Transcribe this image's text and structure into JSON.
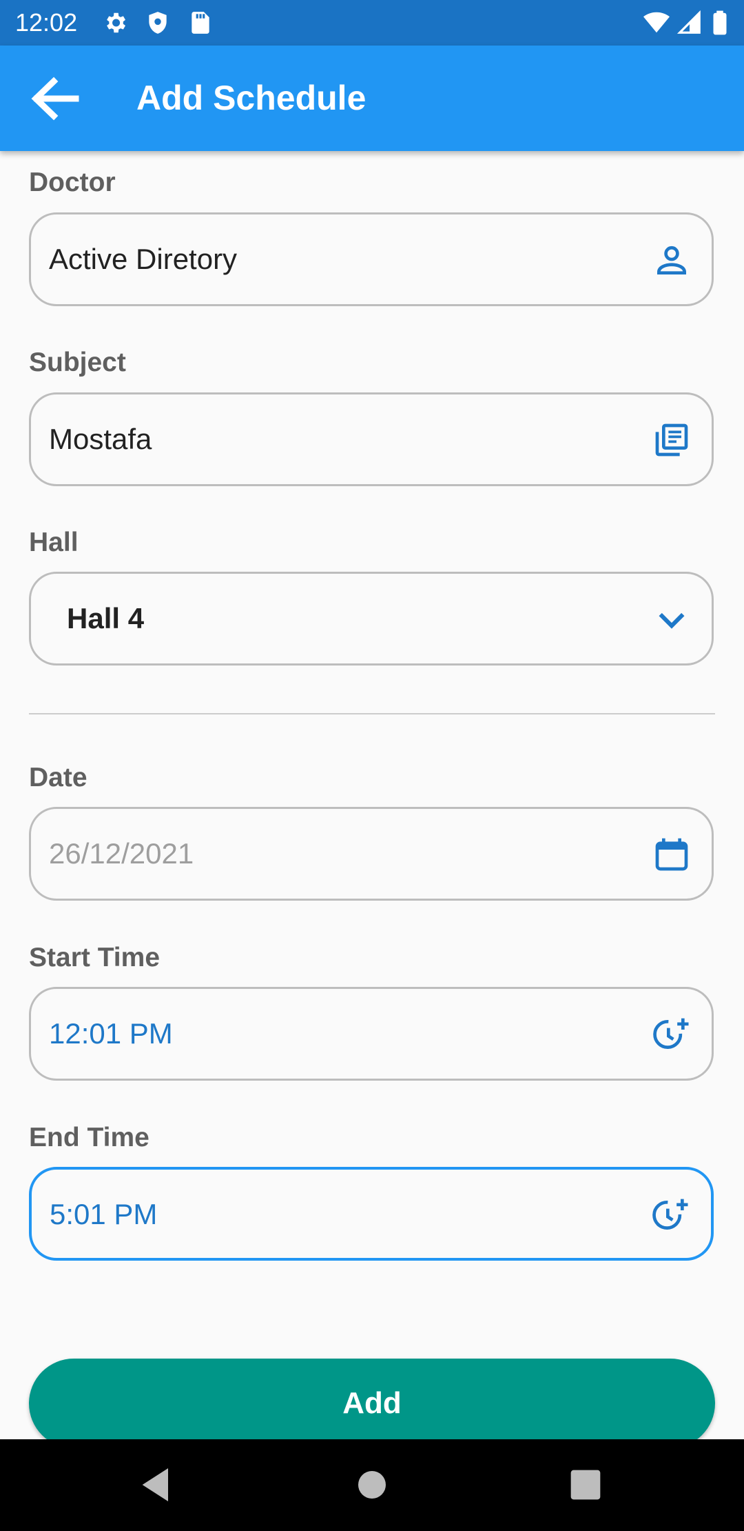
{
  "status_bar": {
    "time": "12:02",
    "icons": [
      "gear-icon",
      "shield-icon",
      "sd-card-icon",
      "wifi-icon",
      "signal-icon",
      "battery-icon"
    ]
  },
  "app_bar": {
    "title": "Add Schedule",
    "back_icon": "arrow-left-icon",
    "color": "#2196f3"
  },
  "form": {
    "doctor": {
      "label": "Doctor",
      "value": "Active Diretory",
      "icon": "person-icon"
    },
    "subject": {
      "label": "Subject",
      "value": "Mostafa",
      "icon": "library-books-icon"
    },
    "hall": {
      "label": "Hall",
      "value": "Hall 4",
      "icon": "chevron-down-icon"
    },
    "date": {
      "label": "Date",
      "value": "26/12/2021",
      "icon": "calendar-icon"
    },
    "start_time": {
      "label": "Start Time",
      "value": "12:01 PM",
      "icon": "clock-add-icon"
    },
    "end_time": {
      "label": "End Time",
      "value": "5:01 PM",
      "icon": "clock-add-icon",
      "focused": true
    }
  },
  "actions": {
    "add_label": "Add",
    "add_color": "#009688"
  },
  "nav_bar": {
    "buttons": [
      "back-triangle-icon",
      "home-circle-icon",
      "recents-square-icon"
    ]
  }
}
